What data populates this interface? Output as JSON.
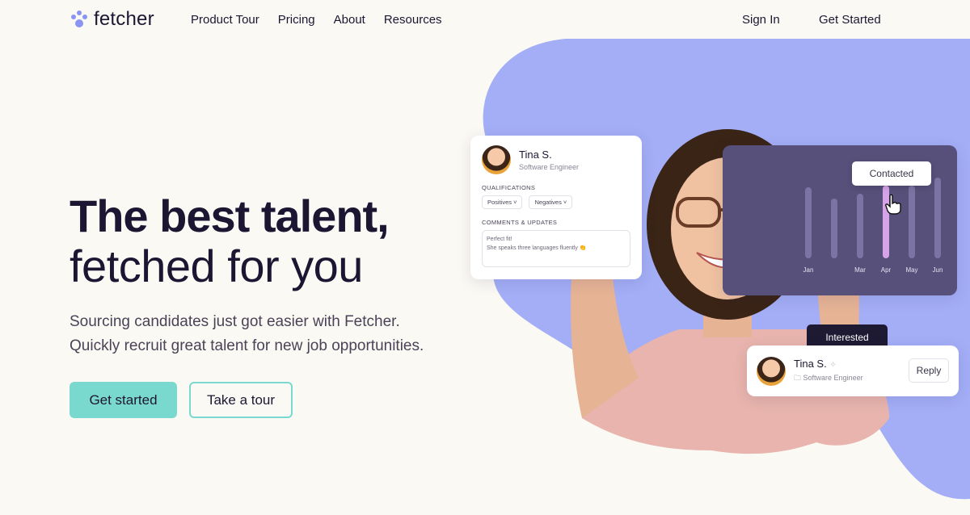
{
  "nav": {
    "logo_text": "fetcher",
    "links": [
      "Product Tour",
      "Pricing",
      "About",
      "Resources"
    ],
    "sign_in": "Sign In",
    "get_started": "Get Started"
  },
  "hero": {
    "title_line1": "The best talent,",
    "title_line2": "fetched for you",
    "subtitle_line1": "Sourcing candidates just got easier with Fetcher.",
    "subtitle_line2": "Quickly recruit great talent for new job opportunities.",
    "primary_cta": "Get started",
    "secondary_cta": "Take a tour"
  },
  "profile_card": {
    "name": "Tina S.",
    "role": "Software Engineer",
    "qualifications_label": "QUALIFICATIONS",
    "chips": [
      "Positives",
      "Negatives"
    ],
    "comments_label": "COMMENTS & UPDATES",
    "comment_line1": "Perfect fit!",
    "comment_line2": "She speaks three languages fluently"
  },
  "chart_card": {
    "tooltip": "Contacted",
    "months": [
      "Jan",
      "Mar",
      "Apr",
      "May",
      "Jun"
    ],
    "highlight_color": "#d6a3e8",
    "bar_color": "#7b74a3"
  },
  "reply_card": {
    "tag": "Interested",
    "name": "Tina S.",
    "role": "Software Engineer",
    "reply_label": "Reply"
  },
  "colors": {
    "accent": "#7ad9cf",
    "blob": "#a3aef6",
    "text": "#1d1632",
    "background": "#fbf9f4"
  }
}
